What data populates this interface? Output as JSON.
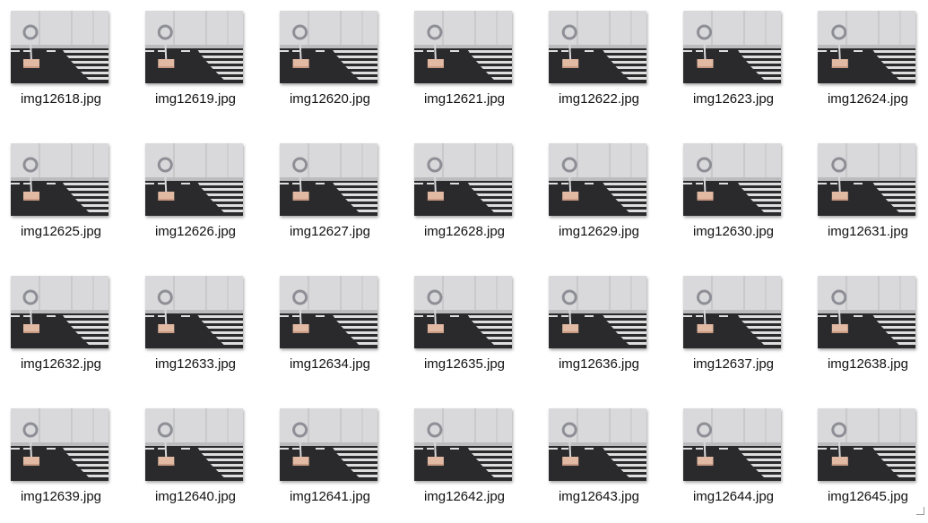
{
  "files": [
    {
      "name": "img12618.jpg"
    },
    {
      "name": "img12619.jpg"
    },
    {
      "name": "img12620.jpg"
    },
    {
      "name": "img12621.jpg"
    },
    {
      "name": "img12622.jpg"
    },
    {
      "name": "img12623.jpg"
    },
    {
      "name": "img12624.jpg"
    },
    {
      "name": "img12625.jpg"
    },
    {
      "name": "img12626.jpg"
    },
    {
      "name": "img12627.jpg"
    },
    {
      "name": "img12628.jpg"
    },
    {
      "name": "img12629.jpg"
    },
    {
      "name": "img12630.jpg"
    },
    {
      "name": "img12631.jpg"
    },
    {
      "name": "img12632.jpg"
    },
    {
      "name": "img12633.jpg"
    },
    {
      "name": "img12634.jpg"
    },
    {
      "name": "img12635.jpg"
    },
    {
      "name": "img12636.jpg"
    },
    {
      "name": "img12637.jpg"
    },
    {
      "name": "img12638.jpg"
    },
    {
      "name": "img12639.jpg"
    },
    {
      "name": "img12640.jpg"
    },
    {
      "name": "img12641.jpg"
    },
    {
      "name": "img12642.jpg"
    },
    {
      "name": "img12643.jpg"
    },
    {
      "name": "img12644.jpg"
    },
    {
      "name": "img12645.jpg"
    }
  ],
  "colors": {
    "wall": "#d9d9db",
    "floor": "#2a2a2c",
    "stripe": "#f2f2f2",
    "block": "#e2b9a2",
    "ring": "#8e8e96"
  }
}
